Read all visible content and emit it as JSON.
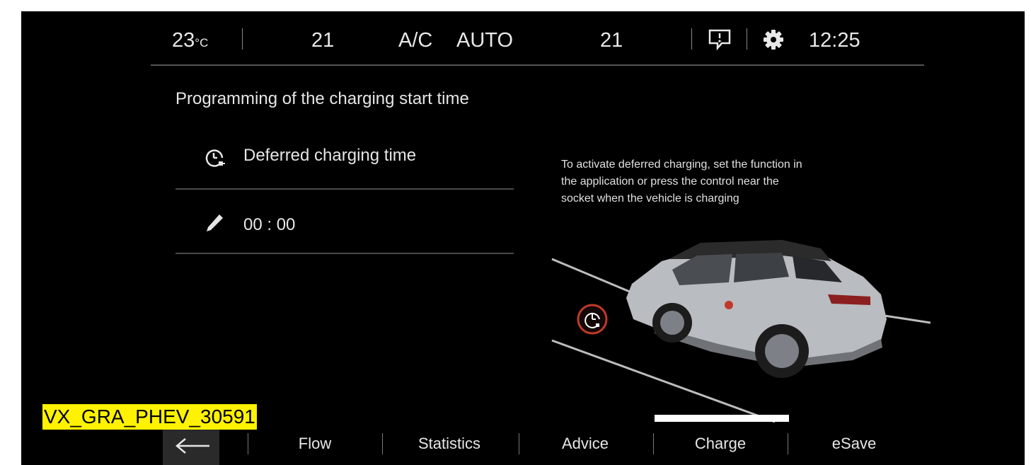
{
  "status_bar": {
    "outside_temp_value": "23",
    "outside_temp_unit": "°C",
    "left_temp": "21",
    "ac_label": "A/C",
    "auto_label": "AUTO",
    "right_temp": "21",
    "clock": "12:25",
    "notification_icon": "message-alert-icon",
    "settings_icon": "gear-icon"
  },
  "panel": {
    "title": "Programming of the charging start time",
    "items": [
      {
        "icon": "clock-plug-icon",
        "label": "Deferred charging time"
      },
      {
        "icon": "pencil-icon",
        "label": "00 : 00"
      }
    ]
  },
  "info_text_lines": [
    "To activate deferred charging, set the function in",
    "the application or press the control near the",
    "socket when the vehicle is charging"
  ],
  "tabs": [
    {
      "label": "Flow"
    },
    {
      "label": "Statistics"
    },
    {
      "label": "Advice"
    },
    {
      "label": "Charge",
      "active": true
    },
    {
      "label": "eSave"
    }
  ],
  "back_icon": "back-arrow-icon",
  "watermark": "VX_GRA_PHEV_30591",
  "colors": {
    "background": "#000000",
    "text": "#e6e6e6",
    "accent": "#ffffff",
    "charge_icon_ring": "#c0392b",
    "watermark_bg": "#fff200"
  }
}
